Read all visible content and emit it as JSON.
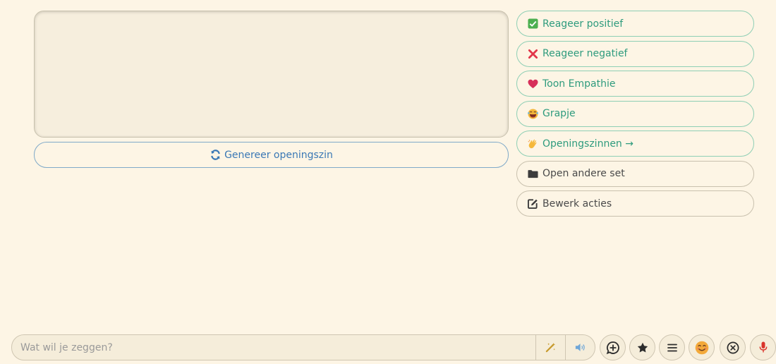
{
  "editor": {
    "value": ""
  },
  "generate_button": {
    "label": "Genereer openingszin"
  },
  "actions": [
    {
      "label": "Reageer positief",
      "icon": "check-icon"
    },
    {
      "label": "Reageer negatief",
      "icon": "cross-icon"
    },
    {
      "label": "Toon Empathie",
      "icon": "heart-icon"
    },
    {
      "label": "Grapje",
      "icon": "laughing-face-icon"
    },
    {
      "label": "Openingszinnen →",
      "icon": "waving-hand-icon"
    },
    {
      "label": "Open andere set",
      "icon": "folder-icon"
    },
    {
      "label": "Bewerk acties",
      "icon": "edit-icon"
    }
  ],
  "chat": {
    "placeholder": "Wat wil je zeggen?"
  },
  "colors": {
    "background": "#fdf5e5",
    "accent_green": "#2e9b7d",
    "accent_blue": "#3a78b5",
    "mic_red": "#d9342b"
  }
}
